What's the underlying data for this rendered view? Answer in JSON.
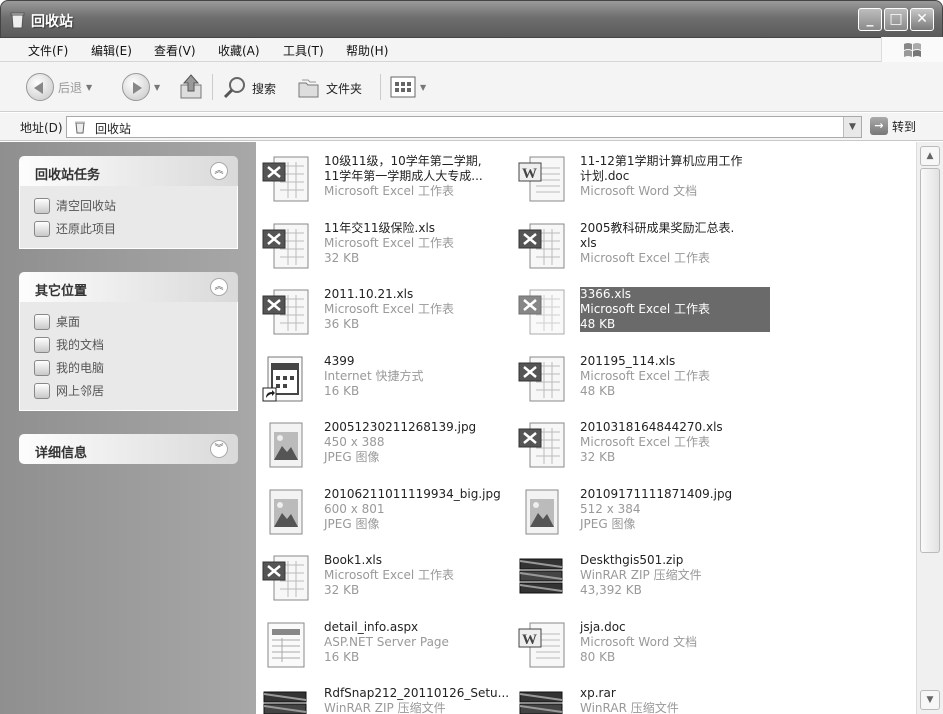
{
  "window": {
    "title": "回收站"
  },
  "menu": {
    "items": [
      "文件(F)",
      "编辑(E)",
      "查看(V)",
      "收藏(A)",
      "工具(T)",
      "帮助(H)"
    ]
  },
  "toolbar": {
    "back_label": "后退",
    "search_label": "搜索",
    "folders_label": "文件夹"
  },
  "address": {
    "label": "地址(D)",
    "value": "回收站",
    "go_label": "转到"
  },
  "tasks_panel": {
    "title": "回收站任务",
    "links": [
      "清空回收站",
      "还原此项目"
    ]
  },
  "other_places_panel": {
    "title": "其它位置",
    "links": [
      "桌面",
      "我的文档",
      "我的电脑",
      "网上邻居"
    ]
  },
  "details_panel": {
    "title": "详细信息"
  },
  "files": [
    {
      "name": "10级11级，10学年第二学期,",
      "name2": "11学年第一学期成人大专成...",
      "type": "Microsoft Excel 工作表",
      "size": "",
      "icon": "excel-icon",
      "selected": false
    },
    {
      "name": "11-12第1学期计算机应用工作",
      "name2": "计划.doc",
      "type": "Microsoft Word 文档",
      "size": "",
      "icon": "word-icon",
      "selected": false
    },
    {
      "name": "11年交11级保险.xls",
      "name2": "",
      "type": "Microsoft Excel 工作表",
      "size": "32 KB",
      "icon": "excel-icon",
      "selected": false
    },
    {
      "name": "2005教科研成果奖励汇总表.",
      "name2": "xls",
      "type": "Microsoft Excel 工作表",
      "size": "",
      "icon": "excel-icon",
      "selected": false
    },
    {
      "name": "2011.10.21.xls",
      "name2": "",
      "type": "Microsoft Excel 工作表",
      "size": "36 KB",
      "icon": "excel-icon",
      "selected": false
    },
    {
      "name": "3366.xls",
      "name2": "",
      "type": "Microsoft Excel 工作表",
      "size": "48 KB",
      "icon": "excel-icon",
      "selected": true
    },
    {
      "name": "4399",
      "name2": "",
      "type": "Internet 快捷方式",
      "size": "16 KB",
      "icon": "shortcut-icon",
      "selected": false
    },
    {
      "name": "201195_114.xls",
      "name2": "",
      "type": "Microsoft Excel 工作表",
      "size": "48 KB",
      "icon": "excel-icon",
      "selected": false
    },
    {
      "name": "20051230211268139.jpg",
      "name2": "",
      "type": "450 x 388",
      "size": "JPEG 图像",
      "icon": "image-icon",
      "selected": false
    },
    {
      "name": "2010318164844270.xls",
      "name2": "",
      "type": "Microsoft Excel 工作表",
      "size": "32 KB",
      "icon": "excel-icon",
      "selected": false
    },
    {
      "name": "20106211011119934_big.jpg",
      "name2": "",
      "type": "600 x 801",
      "size": "JPEG 图像",
      "icon": "image-icon",
      "selected": false
    },
    {
      "name": "20109171111871409.jpg",
      "name2": "",
      "type": "512 x 384",
      "size": "JPEG 图像",
      "icon": "image-icon",
      "selected": false
    },
    {
      "name": "Book1.xls",
      "name2": "",
      "type": "Microsoft Excel 工作表",
      "size": "32 KB",
      "icon": "excel-icon",
      "selected": false
    },
    {
      "name": "Deskthgis501.zip",
      "name2": "",
      "type": "WinRAR ZIP 压缩文件",
      "size": "43,392 KB",
      "icon": "archive-icon",
      "selected": false
    },
    {
      "name": "detail_info.aspx",
      "name2": "",
      "type": "ASP.NET Server Page",
      "size": "16 KB",
      "icon": "aspx-icon",
      "selected": false
    },
    {
      "name": "jsja.doc",
      "name2": "",
      "type": "Microsoft Word 文档",
      "size": "80 KB",
      "icon": "word-icon",
      "selected": false
    },
    {
      "name": "RdfSnap212_20110126_Setu...",
      "name2": "",
      "type": "WinRAR ZIP 压缩文件",
      "size": "",
      "icon": "archive-icon",
      "selected": false
    },
    {
      "name": "xp.rar",
      "name2": "",
      "type": "WinRAR 压缩文件",
      "size": "",
      "icon": "archive-icon",
      "selected": false
    }
  ]
}
